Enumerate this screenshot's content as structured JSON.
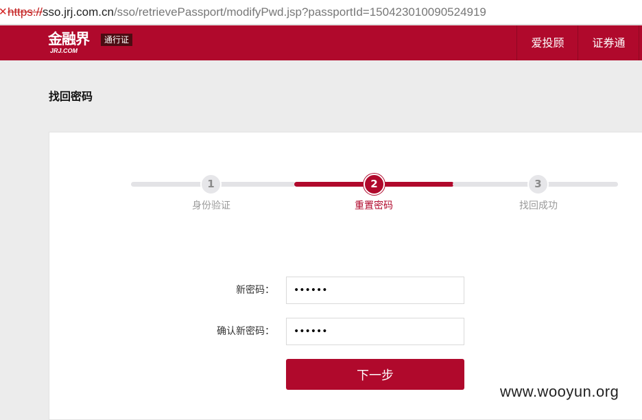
{
  "browser": {
    "error_icon": "x-mark-icon",
    "url_scheme": "https://",
    "url_host": "sso.jrj.com.cn",
    "url_path": "/sso/retrievePassport/modifyPwd.jsp?passportId=150423010090524919"
  },
  "header": {
    "logo_text": "金融界",
    "logo_subtext": "JRJ.COM",
    "badge": "通行证",
    "nav": [
      "爱投顾",
      "证券通"
    ],
    "brand_color": "#b0092c"
  },
  "page": {
    "title": "找回密码"
  },
  "steps": [
    {
      "number": "1",
      "label": "身份验证",
      "active": false
    },
    {
      "number": "2",
      "label": "重置密码",
      "active": true
    },
    {
      "number": "3",
      "label": "找回成功",
      "active": false
    }
  ],
  "form": {
    "new_password_label": "新密码：",
    "new_password_value": "••••••",
    "confirm_password_label": "确认新密码：",
    "confirm_password_value": "••••••",
    "submit_label": "下一步"
  },
  "watermark": "www.wooyun.org"
}
